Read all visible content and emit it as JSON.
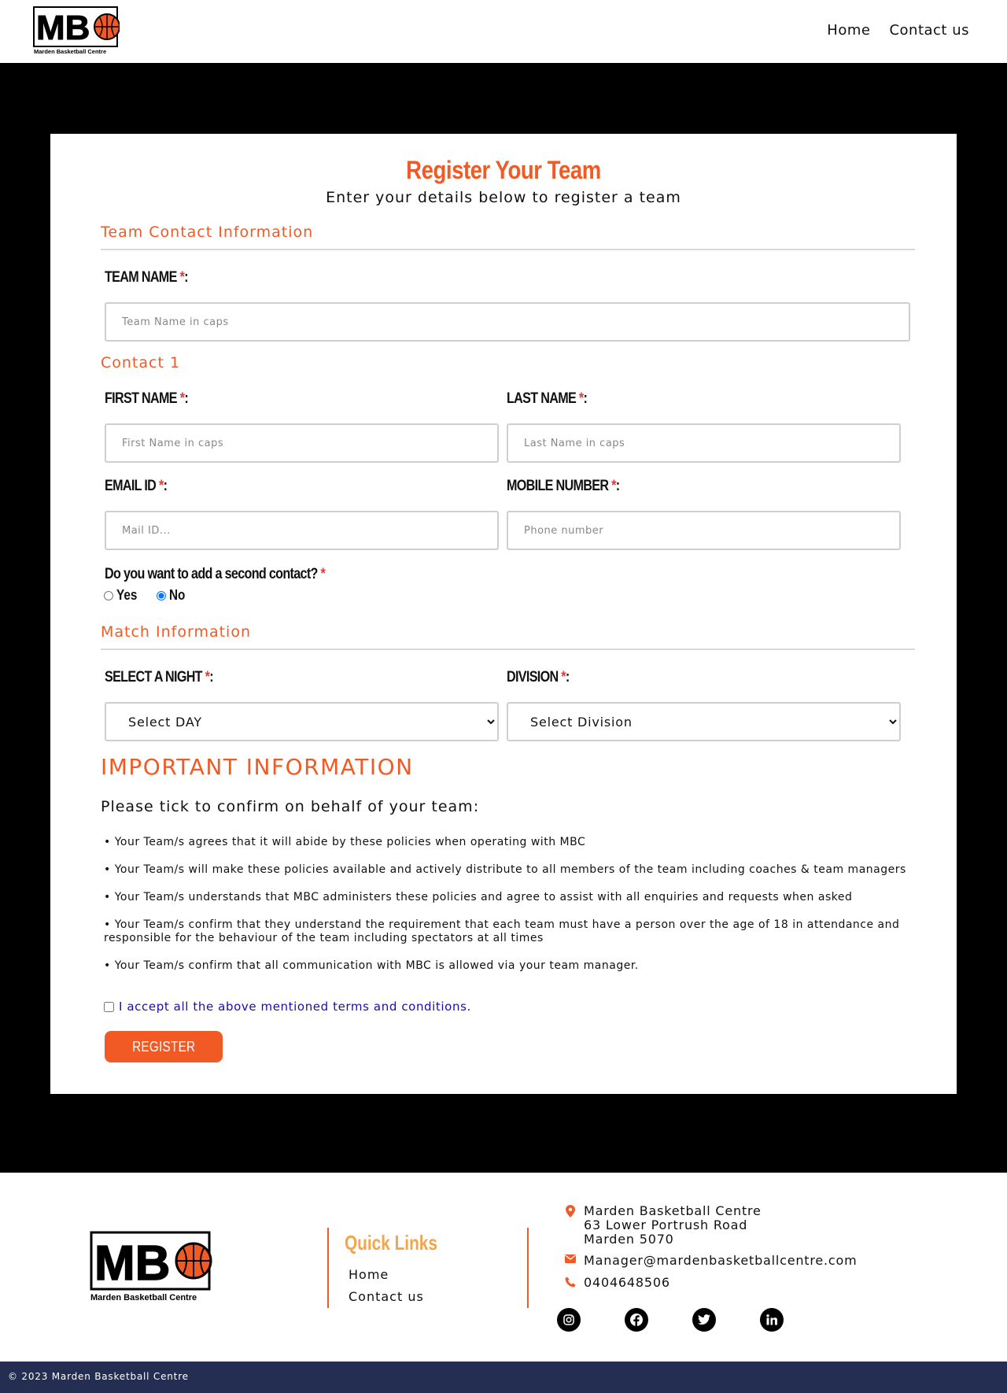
{
  "header": {
    "logo_caption": "Marden Basketball Centre",
    "nav": [
      "Home",
      "Contact us"
    ]
  },
  "form": {
    "title": "Register Your Team",
    "subtitle": "Enter your details below to register a team",
    "sections": {
      "team_contact": "Team Contact Information",
      "contact1": "Contact 1",
      "match": "Match Information"
    },
    "fields": {
      "team_name": {
        "label": "TEAM NAME",
        "placeholder": "Team Name in caps"
      },
      "first_name": {
        "label": "FIRST NAME",
        "placeholder": "First Name in caps"
      },
      "last_name": {
        "label": "LAST NAME",
        "placeholder": "Last Name in caps"
      },
      "email": {
        "label": "EMAIL ID",
        "placeholder": "Mail ID..."
      },
      "mobile": {
        "label": "MOBILE NUMBER",
        "placeholder": "Phone number"
      },
      "night": {
        "label": "SELECT A NIGHT",
        "selected": "Select DAY"
      },
      "division": {
        "label": "DIVISION",
        "selected": "Select Division"
      }
    },
    "required_mark": "*",
    "colon": ":",
    "second_contact": {
      "question": "Do you want to add a second contact?",
      "options": [
        "Yes",
        "No"
      ],
      "selected": "No"
    },
    "important_heading": "IMPORTANT INFORMATION",
    "confirm_text": "Please tick to confirm on behalf of your team:",
    "policies": [
      "• Your Team/s agrees that it will abide by these policies when operating with MBC",
      "• Your Team/s will make these policies available and actively distribute to all members of the team including coaches & team managers",
      "• Your Team/s understands that MBC administers these policies and agree to assist with all enquiries and requests when asked",
      "• Your Team/s confirm that they understand the requirement that each team must have a person over the age of 18 in attendance and responsible for the behaviour of the team including spectators at all times",
      "• Your Team/s confirm that all communication with MBC is allowed via your team manager."
    ],
    "accept_label": "I accept all the above mentioned terms and conditions.",
    "submit_label": "REGISTER"
  },
  "footer": {
    "logo_caption": "Marden Basketball Centre",
    "quick_links_title": "Quick Links",
    "quick_links": [
      "Home",
      "Contact us"
    ],
    "address": [
      "Marden Basketball Centre",
      "63 Lower Portrush Road",
      "Marden 5070"
    ],
    "email": "Manager@mardenbasketballcentre.com",
    "phone": "0404648506",
    "socials": [
      "instagram-icon",
      "facebook-icon",
      "twitter-icon",
      "linkedin-icon"
    ],
    "copyright": "© 2023 Marden Basketball Centre"
  },
  "colors": {
    "accent": "#f15a24",
    "quick_links": "#f4a44a",
    "copyright_bar": "#232e52",
    "band": "#000000"
  }
}
